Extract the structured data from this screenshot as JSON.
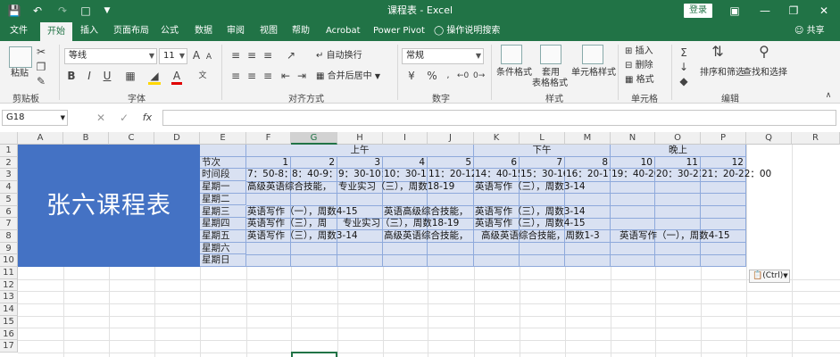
{
  "window": {
    "title": "课程表 - Excel",
    "login_label": "登录"
  },
  "menu": {
    "tabs": [
      "文件",
      "开始",
      "插入",
      "页面布局",
      "公式",
      "数据",
      "审阅",
      "视图",
      "帮助",
      "Acrobat",
      "Power Pivot"
    ],
    "active": "开始",
    "tell_me": "操作说明搜索",
    "share": "共享"
  },
  "ribbon": {
    "clipboard": {
      "paste": "粘贴",
      "label": "剪贴板"
    },
    "font": {
      "name": "等线",
      "size": "11",
      "label": "字体"
    },
    "alignment": {
      "wrap": "自动换行",
      "merge": "合并后居中",
      "label": "对齐方式"
    },
    "number": {
      "format": "常规",
      "label": "数字"
    },
    "styles": {
      "conditional": "条件格式",
      "table_line1": "套用",
      "table_line2": "表格格式",
      "cell_styles": "单元格样式",
      "label": "样式"
    },
    "cells": {
      "insert": "插入",
      "delete": "删除",
      "format": "格式",
      "label": "单元格"
    },
    "editing": {
      "sort": "排序和筛选",
      "find": "查找和选择",
      "label": "编辑"
    }
  },
  "formula_bar": {
    "name_box": "G18",
    "fx": "fx",
    "value": ""
  },
  "sheet": {
    "columns": [
      "A",
      "B",
      "C",
      "D",
      "E",
      "F",
      "G",
      "H",
      "I",
      "J",
      "K",
      "L",
      "M",
      "N",
      "O",
      "P",
      "Q",
      "R"
    ],
    "selected_column": "G",
    "rows": [
      "1",
      "2",
      "3",
      "4",
      "5",
      "6",
      "7",
      "8",
      "9",
      "10",
      "11",
      "12",
      "13",
      "14",
      "15",
      "16",
      "17"
    ],
    "title_cell": "张六课程表",
    "periods_header": {
      "morning": "上午",
      "afternoon": "下午",
      "evening": "晚上"
    },
    "row_labels": [
      "节次",
      "时间段",
      "星期一",
      "星期二",
      "星期三",
      "星期四",
      "星期五",
      "星期六",
      "星期日"
    ],
    "period_numbers": [
      "1",
      "2",
      "3",
      "4",
      "5",
      "6",
      "7",
      "8",
      "10",
      "11",
      "12"
    ],
    "time_slots": [
      "7：50-8：",
      "8：40-9：",
      "9：30-10：",
      "10：30-11：",
      "11：20-12：",
      "14：40-15：",
      "15：30-16：",
      "16：20-17：",
      "19：40-20：",
      "20：30-21：",
      "21：20-22：00"
    ],
    "schedule": {
      "mon": [
        "高级英语综合技能，",
        "专业实习（三），周数18-19",
        "英语写作（三），周数3-14"
      ],
      "wed": [
        "英语写作（一），周数4-15",
        "英语高级综合技能，",
        "英语写作（三），周数3-14"
      ],
      "thu": [
        "英语写作（三），周",
        "专业实习（三），周数18-19",
        "英语写作（三），周数4-15"
      ],
      "fri": [
        "英语写作（三），周数3-14",
        "高级英语综合技能，",
        "高级英语综合技能，周数1-3",
        "英语写作（一），周数4-15"
      ]
    },
    "paste_tag": "(Ctrl)"
  }
}
